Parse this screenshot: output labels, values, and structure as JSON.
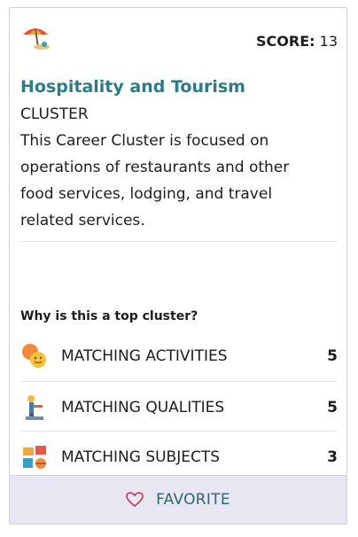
{
  "card": {
    "icon": "beach-umbrella-icon",
    "score_label": "SCORE:",
    "score_value": "13",
    "title": "Hospitality and Tourism",
    "subtitle": "CLUSTER",
    "description": "This Career Cluster is focused on operations of restaurants and other food services, lodging, and travel related services."
  },
  "why": {
    "heading": "Why is this a top cluster?",
    "rows": [
      {
        "icon": "faces-icon",
        "label": "MATCHING ACTIVITIES",
        "value": "5"
      },
      {
        "icon": "award-figure-icon",
        "label": "MATCHING QUALITIES",
        "value": "5"
      },
      {
        "icon": "subjects-icon",
        "label": "MATCHING SUBJECTS",
        "value": "3"
      }
    ]
  },
  "favorite": {
    "label": "FAVORITE",
    "icon": "heart-outline-icon"
  },
  "colors": {
    "title": "#2a7c86",
    "favorite_bg": "#e8e6f2",
    "favorite_text": "#2a6870",
    "heart": "#c0304a"
  }
}
